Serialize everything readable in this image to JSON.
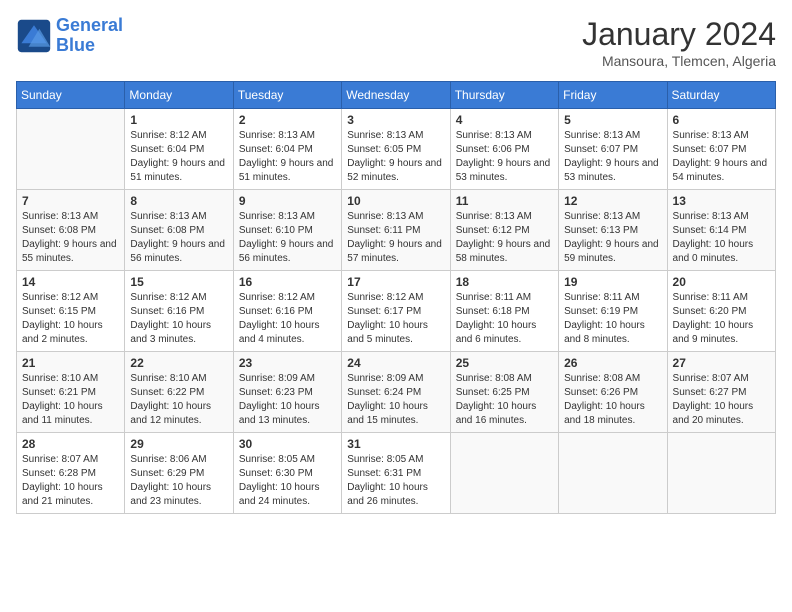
{
  "logo": {
    "line1": "General",
    "line2": "Blue"
  },
  "title": "January 2024",
  "subtitle": "Mansoura, Tlemcen, Algeria",
  "days_of_week": [
    "Sunday",
    "Monday",
    "Tuesday",
    "Wednesday",
    "Thursday",
    "Friday",
    "Saturday"
  ],
  "weeks": [
    [
      {
        "day": "",
        "sunrise": "",
        "sunset": "",
        "daylight": ""
      },
      {
        "day": "1",
        "sunrise": "Sunrise: 8:12 AM",
        "sunset": "Sunset: 6:04 PM",
        "daylight": "Daylight: 9 hours and 51 minutes."
      },
      {
        "day": "2",
        "sunrise": "Sunrise: 8:13 AM",
        "sunset": "Sunset: 6:04 PM",
        "daylight": "Daylight: 9 hours and 51 minutes."
      },
      {
        "day": "3",
        "sunrise": "Sunrise: 8:13 AM",
        "sunset": "Sunset: 6:05 PM",
        "daylight": "Daylight: 9 hours and 52 minutes."
      },
      {
        "day": "4",
        "sunrise": "Sunrise: 8:13 AM",
        "sunset": "Sunset: 6:06 PM",
        "daylight": "Daylight: 9 hours and 53 minutes."
      },
      {
        "day": "5",
        "sunrise": "Sunrise: 8:13 AM",
        "sunset": "Sunset: 6:07 PM",
        "daylight": "Daylight: 9 hours and 53 minutes."
      },
      {
        "day": "6",
        "sunrise": "Sunrise: 8:13 AM",
        "sunset": "Sunset: 6:07 PM",
        "daylight": "Daylight: 9 hours and 54 minutes."
      }
    ],
    [
      {
        "day": "7",
        "sunrise": "Sunrise: 8:13 AM",
        "sunset": "Sunset: 6:08 PM",
        "daylight": "Daylight: 9 hours and 55 minutes."
      },
      {
        "day": "8",
        "sunrise": "Sunrise: 8:13 AM",
        "sunset": "Sunset: 6:08 PM",
        "daylight": "Daylight: 9 hours and 56 minutes."
      },
      {
        "day": "9",
        "sunrise": "Sunrise: 8:13 AM",
        "sunset": "Sunset: 6:10 PM",
        "daylight": "Daylight: 9 hours and 56 minutes."
      },
      {
        "day": "10",
        "sunrise": "Sunrise: 8:13 AM",
        "sunset": "Sunset: 6:11 PM",
        "daylight": "Daylight: 9 hours and 57 minutes."
      },
      {
        "day": "11",
        "sunrise": "Sunrise: 8:13 AM",
        "sunset": "Sunset: 6:12 PM",
        "daylight": "Daylight: 9 hours and 58 minutes."
      },
      {
        "day": "12",
        "sunrise": "Sunrise: 8:13 AM",
        "sunset": "Sunset: 6:13 PM",
        "daylight": "Daylight: 9 hours and 59 minutes."
      },
      {
        "day": "13",
        "sunrise": "Sunrise: 8:13 AM",
        "sunset": "Sunset: 6:14 PM",
        "daylight": "Daylight: 10 hours and 0 minutes."
      }
    ],
    [
      {
        "day": "14",
        "sunrise": "Sunrise: 8:12 AM",
        "sunset": "Sunset: 6:15 PM",
        "daylight": "Daylight: 10 hours and 2 minutes."
      },
      {
        "day": "15",
        "sunrise": "Sunrise: 8:12 AM",
        "sunset": "Sunset: 6:16 PM",
        "daylight": "Daylight: 10 hours and 3 minutes."
      },
      {
        "day": "16",
        "sunrise": "Sunrise: 8:12 AM",
        "sunset": "Sunset: 6:16 PM",
        "daylight": "Daylight: 10 hours and 4 minutes."
      },
      {
        "day": "17",
        "sunrise": "Sunrise: 8:12 AM",
        "sunset": "Sunset: 6:17 PM",
        "daylight": "Daylight: 10 hours and 5 minutes."
      },
      {
        "day": "18",
        "sunrise": "Sunrise: 8:11 AM",
        "sunset": "Sunset: 6:18 PM",
        "daylight": "Daylight: 10 hours and 6 minutes."
      },
      {
        "day": "19",
        "sunrise": "Sunrise: 8:11 AM",
        "sunset": "Sunset: 6:19 PM",
        "daylight": "Daylight: 10 hours and 8 minutes."
      },
      {
        "day": "20",
        "sunrise": "Sunrise: 8:11 AM",
        "sunset": "Sunset: 6:20 PM",
        "daylight": "Daylight: 10 hours and 9 minutes."
      }
    ],
    [
      {
        "day": "21",
        "sunrise": "Sunrise: 8:10 AM",
        "sunset": "Sunset: 6:21 PM",
        "daylight": "Daylight: 10 hours and 11 minutes."
      },
      {
        "day": "22",
        "sunrise": "Sunrise: 8:10 AM",
        "sunset": "Sunset: 6:22 PM",
        "daylight": "Daylight: 10 hours and 12 minutes."
      },
      {
        "day": "23",
        "sunrise": "Sunrise: 8:09 AM",
        "sunset": "Sunset: 6:23 PM",
        "daylight": "Daylight: 10 hours and 13 minutes."
      },
      {
        "day": "24",
        "sunrise": "Sunrise: 8:09 AM",
        "sunset": "Sunset: 6:24 PM",
        "daylight": "Daylight: 10 hours and 15 minutes."
      },
      {
        "day": "25",
        "sunrise": "Sunrise: 8:08 AM",
        "sunset": "Sunset: 6:25 PM",
        "daylight": "Daylight: 10 hours and 16 minutes."
      },
      {
        "day": "26",
        "sunrise": "Sunrise: 8:08 AM",
        "sunset": "Sunset: 6:26 PM",
        "daylight": "Daylight: 10 hours and 18 minutes."
      },
      {
        "day": "27",
        "sunrise": "Sunrise: 8:07 AM",
        "sunset": "Sunset: 6:27 PM",
        "daylight": "Daylight: 10 hours and 20 minutes."
      }
    ],
    [
      {
        "day": "28",
        "sunrise": "Sunrise: 8:07 AM",
        "sunset": "Sunset: 6:28 PM",
        "daylight": "Daylight: 10 hours and 21 minutes."
      },
      {
        "day": "29",
        "sunrise": "Sunrise: 8:06 AM",
        "sunset": "Sunset: 6:29 PM",
        "daylight": "Daylight: 10 hours and 23 minutes."
      },
      {
        "day": "30",
        "sunrise": "Sunrise: 8:05 AM",
        "sunset": "Sunset: 6:30 PM",
        "daylight": "Daylight: 10 hours and 24 minutes."
      },
      {
        "day": "31",
        "sunrise": "Sunrise: 8:05 AM",
        "sunset": "Sunset: 6:31 PM",
        "daylight": "Daylight: 10 hours and 26 minutes."
      },
      {
        "day": "",
        "sunrise": "",
        "sunset": "",
        "daylight": ""
      },
      {
        "day": "",
        "sunrise": "",
        "sunset": "",
        "daylight": ""
      },
      {
        "day": "",
        "sunrise": "",
        "sunset": "",
        "daylight": ""
      }
    ]
  ]
}
